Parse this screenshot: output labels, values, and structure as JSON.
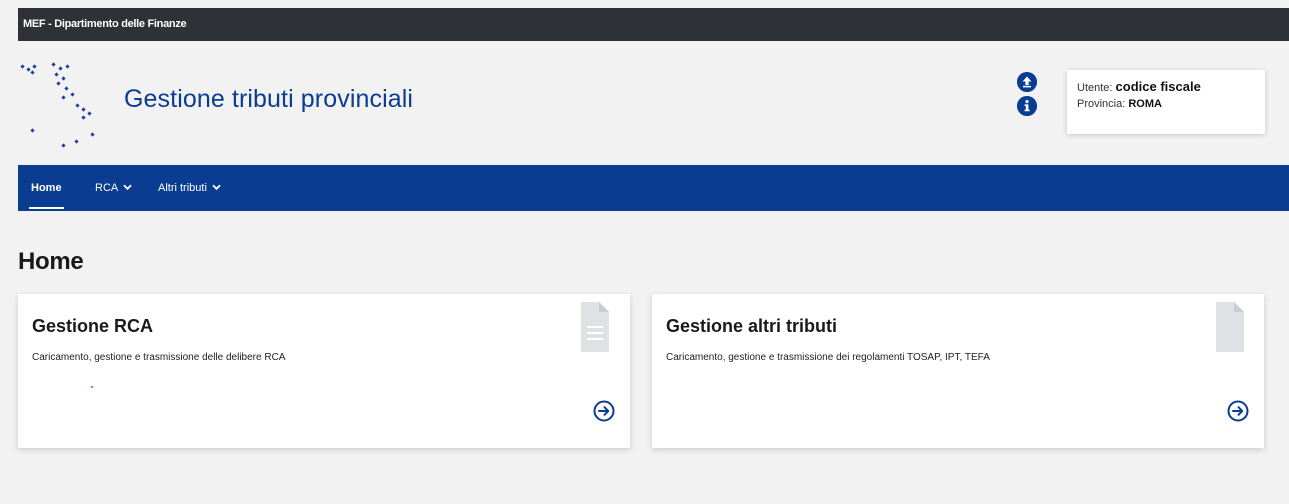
{
  "topbar": {
    "label": "MEF - Dipartimento delle Finanze"
  },
  "header": {
    "title": "Gestione tributi provinciali",
    "icons": [
      "upload-icon",
      "info-icon"
    ]
  },
  "user": {
    "utente_label": "Utente:",
    "utente_value": "codice fiscale",
    "provincia_label": "Provincia:",
    "provincia_value": "ROMA"
  },
  "nav": {
    "items": [
      {
        "label": "Home",
        "active": true
      },
      {
        "label": "RCA",
        "dropdown": true
      },
      {
        "label": "Altri tributi",
        "dropdown": true
      }
    ]
  },
  "page": {
    "heading": "Home"
  },
  "cards": [
    {
      "title": "Gestione RCA",
      "description": "Caricamento, gestione e trasmissione delle delibere RCA",
      "icon": "document-text-icon"
    },
    {
      "title": "Gestione altri tributi",
      "description": "Caricamento, gestione e trasmissione dei regolamenti TOSAP, IPT, TEFA",
      "icon": "document-blank-icon"
    }
  ],
  "colors": {
    "brand_blue": "#0a3d91",
    "topbar": "#2e3136",
    "background": "#f2f2f2"
  }
}
